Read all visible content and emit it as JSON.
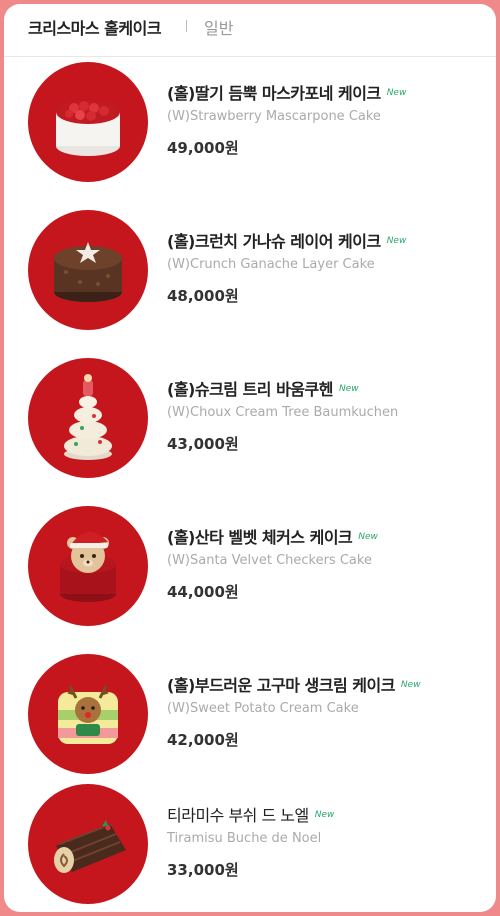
{
  "tabs": {
    "active": "크리스마스 홀케이크",
    "other": "일반"
  },
  "items": [
    {
      "name": "(홀)딸기 듬뿍 마스카포네 케이크",
      "eng": "(W)Strawberry Mascarpone Cake",
      "price": "49,000원",
      "badge": "New",
      "icon": "strawberry-cake-icon"
    },
    {
      "name": "(홀)크런치 가나슈 레이어 케이크",
      "eng": "(W)Crunch Ganache Layer Cake",
      "price": "48,000원",
      "badge": "New",
      "icon": "chocolate-cake-icon"
    },
    {
      "name": "(홀)슈크림 트리 바움쿠헨",
      "eng": "(W)Choux Cream Tree Baumkuchen",
      "price": "43,000원",
      "badge": "New",
      "icon": "tree-cake-icon"
    },
    {
      "name": "(홀)산타 벨벳 체커스 케이크",
      "eng": "(W)Santa Velvet Checkers Cake",
      "price": "44,000원",
      "badge": "New",
      "icon": "santa-bear-cake-icon"
    },
    {
      "name": "(홀)부드러운 고구마 생크림 케이크",
      "eng": "(W)Sweet Potato Cream Cake",
      "price": "42,000원",
      "badge": "New",
      "icon": "reindeer-cake-icon"
    },
    {
      "name": "티라미수 부쉬 드 노엘",
      "eng": "Tiramisu Buche de Noel",
      "price": "33,000원",
      "badge": "New",
      "icon": "buche-de-noel-icon"
    }
  ],
  "colors": {
    "thumb_bg": "#c4161c",
    "new_badge": "#2aa86a",
    "frame": "#f08a8a"
  }
}
